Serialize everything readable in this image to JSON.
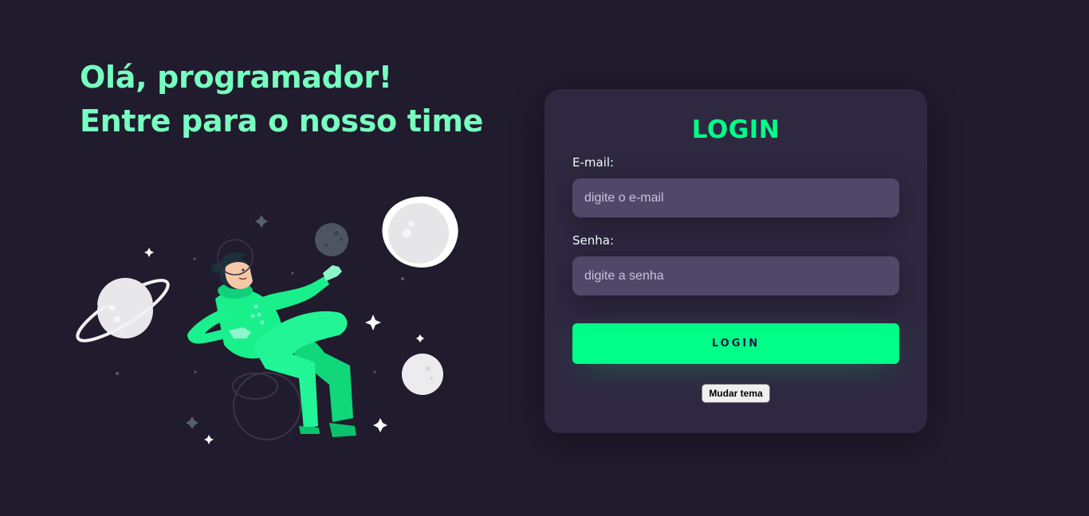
{
  "hero": {
    "line1": "Olá, programador!",
    "line2": "Entre para o nosso time"
  },
  "illustration": {
    "icon": "astronaut-in-space-illustration"
  },
  "login": {
    "title": "LOGIN",
    "email": {
      "label": "E-mail:",
      "placeholder": "digite o e-mail",
      "value": ""
    },
    "password": {
      "label": "Senha:",
      "placeholder": "digite a senha",
      "value": ""
    },
    "submit_label": "LOGIN",
    "theme_button_label": "Mudar tema"
  },
  "colors": {
    "background": "#201b2d",
    "card": "#2f2841",
    "input": "#514869",
    "accent": "#00ff88",
    "heading": "#77ffc0"
  }
}
